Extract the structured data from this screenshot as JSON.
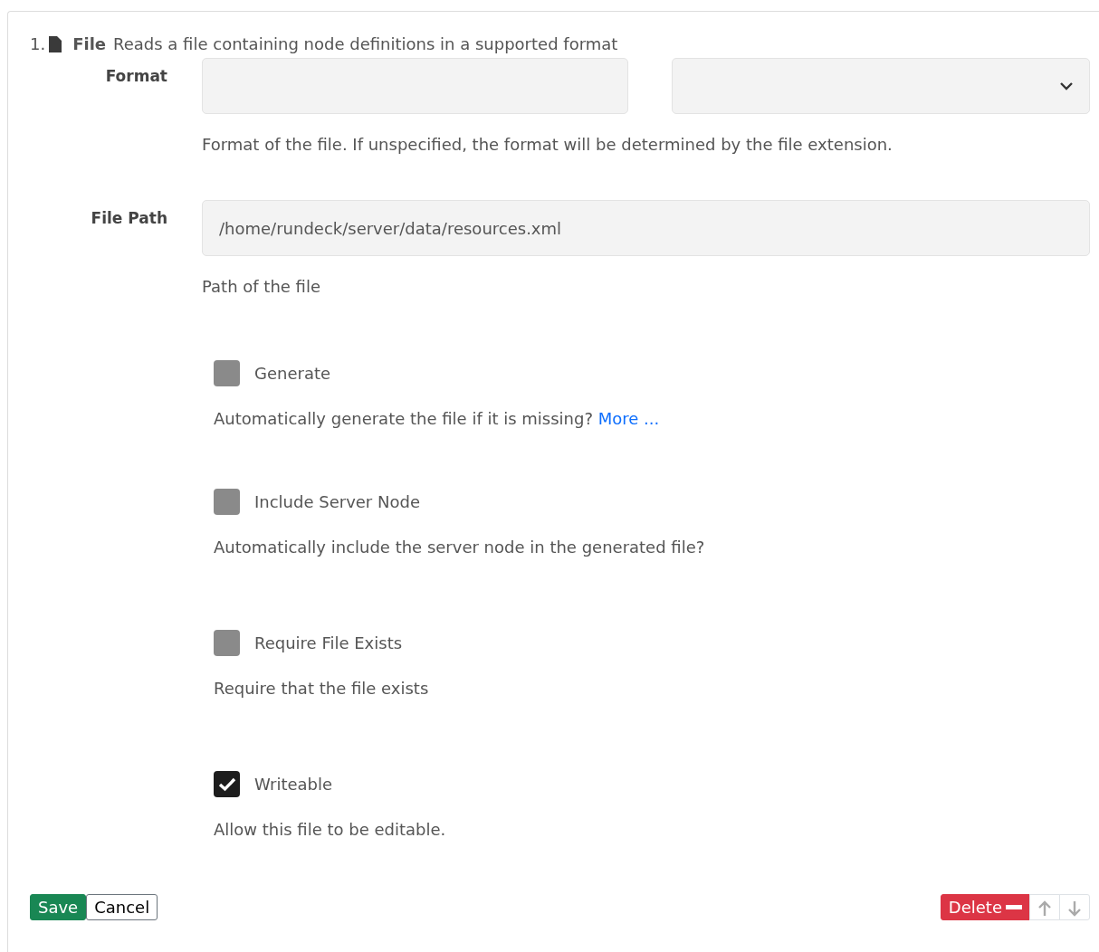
{
  "header": {
    "index": "1.",
    "title": "File",
    "description": "Reads a file containing node definitions in a supported format"
  },
  "format": {
    "label": "Format",
    "help": "Format of the file. If unspecified, the format will be determined by the file extension."
  },
  "file_path": {
    "label": "File Path",
    "value": "/home/rundeck/server/data/resources.xml",
    "help": "Path of the file"
  },
  "options": [
    {
      "label": "Generate",
      "checked": false,
      "help": "Automatically generate the file if it is missing?",
      "link": "More ..."
    },
    {
      "label": "Include Server Node",
      "checked": false,
      "help": "Automatically include the server node in the generated file?"
    },
    {
      "label": "Require File Exists",
      "checked": false,
      "help": "Require that the file exists"
    },
    {
      "label": "Writeable",
      "checked": true,
      "help": "Allow this file to be editable."
    }
  ],
  "buttons": {
    "save": "Save",
    "cancel": "Cancel",
    "delete": "Delete"
  }
}
